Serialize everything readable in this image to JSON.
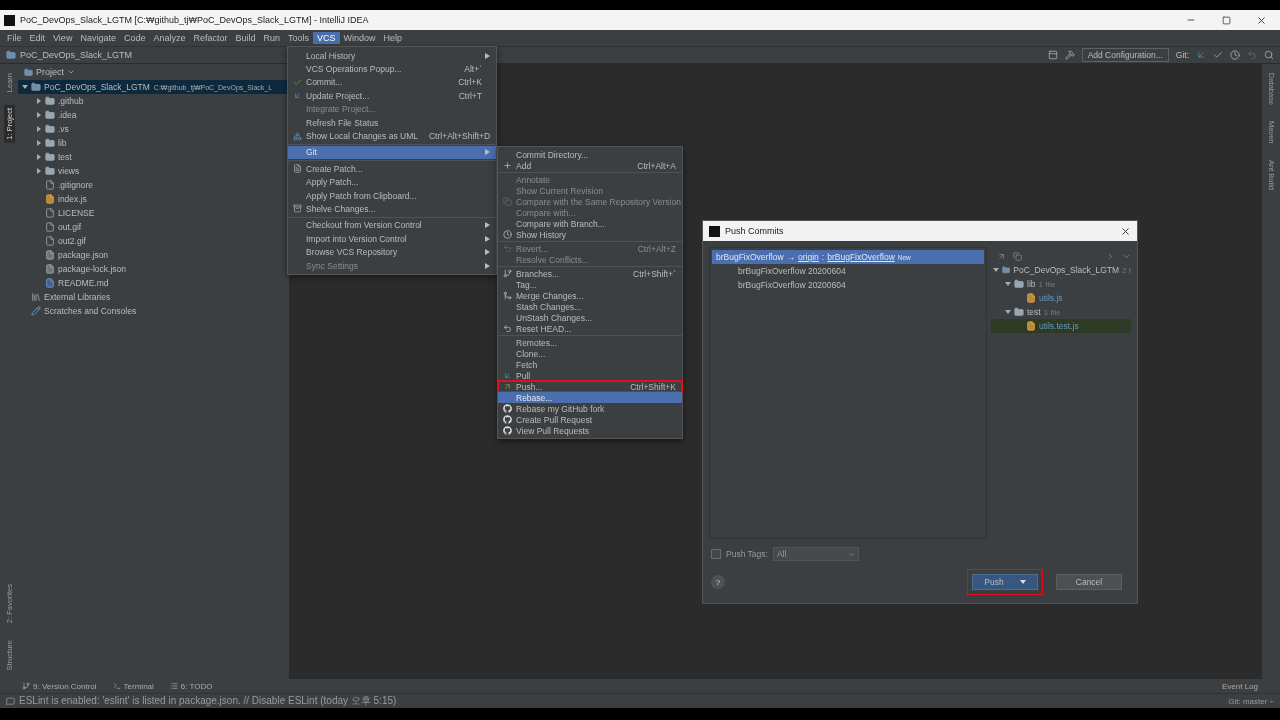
{
  "window": {
    "title": "PoC_DevOps_Slack_LGTM [C:₩github_tj₩PoC_DevOps_Slack_LGTM] - IntelliJ IDEA"
  },
  "menu_bar": [
    {
      "label": "File",
      "selected": false
    },
    {
      "label": "Edit",
      "selected": false
    },
    {
      "label": "View",
      "selected": false
    },
    {
      "label": "Navigate",
      "selected": false
    },
    {
      "label": "Code",
      "selected": false
    },
    {
      "label": "Analyze",
      "selected": false
    },
    {
      "label": "Refactor",
      "selected": false
    },
    {
      "label": "Build",
      "selected": false
    },
    {
      "label": "Run",
      "selected": false
    },
    {
      "label": "Tools",
      "selected": false
    },
    {
      "label": "VCS",
      "selected": true
    },
    {
      "label": "Window",
      "selected": false
    },
    {
      "label": "Help",
      "selected": false
    }
  ],
  "nav_bar": {
    "breadcrumb": "PoC_DevOps_Slack_LGTM",
    "add_configuration": "Add Configuration...",
    "git_label": "Git:"
  },
  "left_stripe": {
    "top": [
      {
        "label": "Learn",
        "selected": false
      },
      {
        "label": "1: Project",
        "selected": true
      }
    ],
    "bottom": [
      {
        "label": "2: Favorites",
        "selected": false
      },
      {
        "label": "Structure",
        "selected": false
      }
    ]
  },
  "right_stripe": [
    "Database",
    "Maven",
    "Ant Build"
  ],
  "project_panel": {
    "title": "Project",
    "tree": [
      {
        "label": "PoC_DevOps_Slack_LGTM",
        "path": "C:₩github_tj₩PoC_DevOps_Slack_L",
        "kind": "module",
        "expanded": true,
        "selected": true,
        "children": [
          {
            "label": ".github",
            "kind": "folder",
            "expanded": false,
            "selected": false
          },
          {
            "label": ".idea",
            "kind": "folder",
            "expanded": false,
            "selected": false
          },
          {
            "label": ".vs",
            "kind": "folder",
            "expanded": false,
            "selected": false
          },
          {
            "label": "lib",
            "kind": "folder",
            "expanded": false,
            "selected": false
          },
          {
            "label": "test",
            "kind": "folder",
            "expanded": false,
            "selected": false
          },
          {
            "label": "views",
            "kind": "folder",
            "expanded": false,
            "selected": false
          },
          {
            "label": ".gitignore",
            "kind": "file",
            "selected": false
          },
          {
            "label": "index.js",
            "kind": "js",
            "selected": false
          },
          {
            "label": "LICENSE",
            "kind": "file",
            "selected": false
          },
          {
            "label": "out.gif",
            "kind": "file",
            "selected": false
          },
          {
            "label": "out2.gif",
            "kind": "file",
            "selected": false
          },
          {
            "label": "package.json",
            "kind": "json",
            "selected": false
          },
          {
            "label": "package-lock.json",
            "kind": "json",
            "selected": false
          },
          {
            "label": "README.md",
            "kind": "md",
            "selected": false
          }
        ]
      },
      {
        "label": "External Libraries",
        "kind": "library",
        "selected": false
      },
      {
        "label": "Scratches and Consoles",
        "kind": "scratch",
        "selected": false
      }
    ]
  },
  "vcs_menu": {
    "groups": [
      [
        {
          "label": "Local History",
          "submenu": true,
          "disabled": false,
          "selected": false
        },
        {
          "label": "VCS Operations Popup...",
          "shortcut": "Alt+`",
          "submenu": false,
          "disabled": false,
          "selected": false
        },
        {
          "label": "Commit...",
          "shortcut": "Ctrl+K",
          "kind": "commit",
          "submenu": false,
          "disabled": false,
          "selected": false
        },
        {
          "label": "Update Project...",
          "shortcut": "Ctrl+T",
          "kind": "update",
          "submenu": false,
          "disabled": false,
          "selected": false
        },
        {
          "label": "Integrate Project...",
          "submenu": false,
          "disabled": true,
          "selected": false
        },
        {
          "label": "Refresh File Status",
          "submenu": false,
          "disabled": false,
          "selected": false
        },
        {
          "label": "Show Local Changes as UML",
          "shortcut": "Ctrl+Alt+Shift+D",
          "kind": "uml",
          "submenu": false,
          "disabled": false,
          "selected": false
        }
      ],
      [
        {
          "label": "Git",
          "submenu": true,
          "disabled": false,
          "selected": true
        }
      ],
      [
        {
          "label": "Create Patch...",
          "kind": "patch",
          "submenu": false,
          "disabled": false,
          "selected": false
        },
        {
          "label": "Apply Patch...",
          "submenu": false,
          "disabled": false,
          "selected": false
        },
        {
          "label": "Apply Patch from Clipboard...",
          "submenu": false,
          "disabled": false,
          "selected": false
        },
        {
          "label": "Shelve Changes...",
          "kind": "shelve",
          "submenu": false,
          "disabled": false,
          "selected": false
        }
      ],
      [
        {
          "label": "Checkout from Version Control",
          "submenu": true,
          "disabled": false,
          "selected": false
        },
        {
          "label": "Import into Version Control",
          "submenu": true,
          "disabled": false,
          "selected": false
        },
        {
          "label": "Browse VCS Repository",
          "submenu": true,
          "disabled": false,
          "selected": false
        },
        {
          "label": "Sync Settings",
          "submenu": true,
          "disabled": true,
          "selected": false
        }
      ]
    ]
  },
  "git_menu": {
    "groups": [
      [
        {
          "label": "Commit Directory...",
          "disabled": false,
          "selected": false,
          "highlighted": false
        },
        {
          "label": "Add",
          "shortcut": "Ctrl+Alt+A",
          "kind": "add",
          "disabled": false,
          "selected": false,
          "highlighted": false
        }
      ],
      [
        {
          "label": "Annotate",
          "disabled": true,
          "selected": false,
          "highlighted": false
        },
        {
          "label": "Show Current Revision",
          "disabled": true,
          "selected": false,
          "highlighted": false
        },
        {
          "label": "Compare with the Same Repository Version",
          "kind": "compare",
          "disabled": true,
          "selected": false,
          "highlighted": false
        },
        {
          "label": "Compare with...",
          "disabled": true,
          "selected": false,
          "highlighted": false
        },
        {
          "label": "Compare with Branch...",
          "disabled": false,
          "selected": false,
          "highlighted": false
        },
        {
          "label": "Show History",
          "kind": "history",
          "disabled": false,
          "selected": false,
          "highlighted": false
        }
      ],
      [
        {
          "label": "Revert...",
          "shortcut": "Ctrl+Alt+Z",
          "kind": "revert",
          "disabled": true,
          "selected": false,
          "highlighted": false
        },
        {
          "label": "Resolve Conflicts...",
          "disabled": true,
          "selected": false,
          "highlighted": false
        }
      ],
      [
        {
          "label": "Branches...",
          "shortcut": "Ctrl+Shift+`",
          "kind": "branch",
          "disabled": false,
          "selected": false,
          "highlighted": false
        },
        {
          "label": "Tag...",
          "disabled": false,
          "selected": false,
          "highlighted": false
        },
        {
          "label": "Merge Changes...",
          "kind": "merge",
          "disabled": false,
          "selected": false,
          "highlighted": false
        },
        {
          "label": "Stash Changes...",
          "disabled": false,
          "selected": false,
          "highlighted": false
        },
        {
          "label": "UnStash Changes...",
          "disabled": false,
          "selected": false,
          "highlighted": false
        },
        {
          "label": "Reset HEAD...",
          "kind": "reset",
          "disabled": false,
          "selected": false,
          "highlighted": false
        }
      ],
      [
        {
          "label": "Remotes...",
          "disabled": false,
          "selected": false,
          "highlighted": false
        },
        {
          "label": "Clone...",
          "disabled": false,
          "selected": false,
          "highlighted": false
        },
        {
          "label": "Fetch",
          "disabled": false,
          "selected": false,
          "highlighted": false
        },
        {
          "label": "Pull",
          "kind": "pull",
          "disabled": false,
          "selected": false,
          "highlighted": false
        },
        {
          "label": "Push...",
          "shortcut": "Ctrl+Shift+K",
          "kind": "push",
          "disabled": false,
          "selected": false,
          "highlighted": true
        },
        {
          "label": "Rebase...",
          "disabled": false,
          "selected": true,
          "highlighted": false
        },
        {
          "label": "Rebase my GitHub fork",
          "kind": "github",
          "disabled": false,
          "selected": false,
          "highlighted": false
        },
        {
          "label": "Create Pull Request",
          "kind": "github",
          "disabled": false,
          "selected": false,
          "highlighted": false
        },
        {
          "label": "View Pull Requests",
          "kind": "github",
          "disabled": false,
          "selected": false,
          "highlighted": false
        }
      ]
    ]
  },
  "push_dialog": {
    "title": "Push Commits",
    "branch": {
      "local": "brBugFixOverflow",
      "arrow": "→",
      "remote": "origin",
      "separator": ":",
      "target": "brBugFixOverflow",
      "badge": "New",
      "selected": true
    },
    "commits": [
      "brBugFixOverflow 20200604",
      "brBugFixOverflow 20200604"
    ],
    "files": [
      {
        "label": "PoC_DevOps_Slack_LGTM",
        "count": "2 f",
        "kind": "module",
        "selected": false,
        "children": [
          {
            "label": "lib",
            "count": "1 file",
            "kind": "folder",
            "selected": false,
            "children": [
              {
                "label": "utils.js",
                "kind": "js",
                "selected": false
              }
            ]
          },
          {
            "label": "test",
            "count": "1 file",
            "kind": "folder",
            "selected": false,
            "children": [
              {
                "label": "utils.test.js",
                "kind": "js",
                "selected": true
              }
            ]
          }
        ]
      }
    ],
    "push_tags": {
      "label": "Push Tags:",
      "checked": false,
      "value": "All"
    },
    "help": "?",
    "buttons": [
      {
        "label": "Push",
        "kind": "primary",
        "highlighted": true
      },
      {
        "label": "Cancel",
        "kind": "secondary",
        "highlighted": false
      }
    ]
  },
  "tool_windows": [
    {
      "label": "9: Version Control",
      "kind": "vcs"
    },
    {
      "label": "Terminal",
      "kind": "terminal"
    },
    {
      "label": "6: TODO",
      "kind": "todo"
    }
  ],
  "event_log": "Event Log",
  "status_bar": {
    "message": "ESLint is enabled: 'eslint' is listed in package.json. // Disable ESLint (today 오후 5:15)",
    "branch": "Git: master ÷"
  }
}
